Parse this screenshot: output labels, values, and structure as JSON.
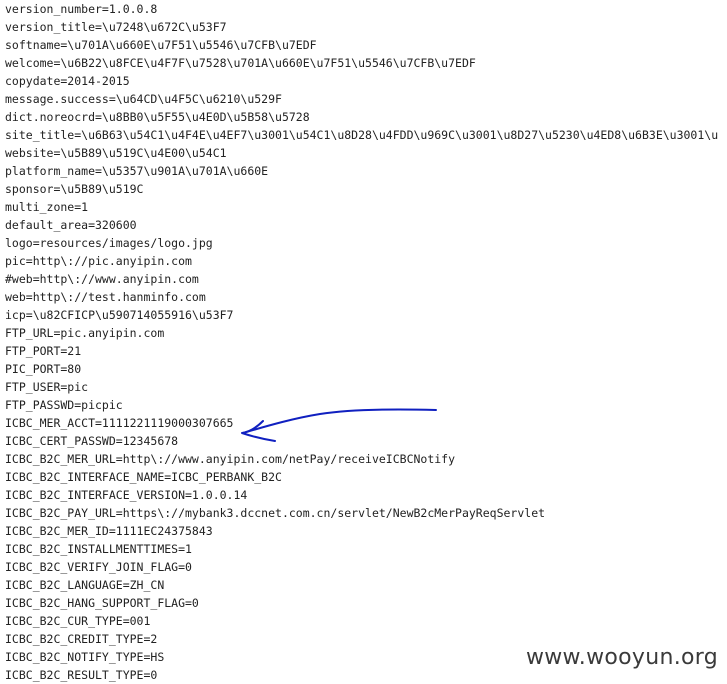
{
  "file": {
    "lines": [
      "version_number=1.0.0.8",
      "version_title=\\u7248\\u672C\\u53F7",
      "softname=\\u701A\\u660E\\u7F51\\u5546\\u7CFB\\u7EDF",
      "welcome=\\u6B22\\u8FCE\\u4F7F\\u7528\\u701A\\u660E\\u7F51\\u5546\\u7CFB\\u7EDF",
      "copydate=2014-2015",
      "message.success=\\u64CD\\u4F5C\\u6210\\u529F",
      "dict.noreocrd=\\u8BB0\\u5F55\\u4E0D\\u5B58\\u5728",
      "site_title=\\u6B63\\u54C1\\u4F4E\\u4EF7\\u3001\\u54C1\\u8D28\\u4FDD\\u969C\\u3001\\u8D27\\u5230\\u4ED8\\u6B3E\\u3001\\u",
      "website=\\u5B89\\u519C\\u4E00\\u54C1",
      "platform_name=\\u5357\\u901A\\u701A\\u660E",
      "sponsor=\\u5B89\\u519C",
      "multi_zone=1",
      "default_area=320600",
      "logo=resources/images/logo.jpg",
      "pic=http\\://pic.anyipin.com",
      "#web=http\\://www.anyipin.com",
      "web=http\\://test.hanminfo.com",
      "icp=\\u82CFICP\\u590714055916\\u53F7",
      "FTP_URL=pic.anyipin.com",
      "FTP_PORT=21",
      "PIC_PORT=80",
      "FTP_USER=pic",
      "FTP_PASSWD=picpic",
      "ICBC_MER_ACCT=1111221119000307665",
      "ICBC_CERT_PASSWD=12345678",
      "ICBC_B2C_MER_URL=http\\://www.anyipin.com/netPay/receiveICBCNotify",
      "ICBC_B2C_INTERFACE_NAME=ICBC_PERBANK_B2C",
      "ICBC_B2C_INTERFACE_VERSION=1.0.0.14",
      "ICBC_B2C_PAY_URL=https\\://mybank3.dccnet.com.cn/servlet/NewB2cMerPayReqServlet",
      "ICBC_B2C_MER_ID=1111EC24375843",
      "ICBC_B2C_INSTALLMENTTIMES=1",
      "ICBC_B2C_VERIFY_JOIN_FLAG=0",
      "ICBC_B2C_LANGUAGE=ZH_CN",
      "ICBC_B2C_HANG_SUPPORT_FLAG=0",
      "ICBC_B2C_CUR_TYPE=001",
      "ICBC_B2C_CREDIT_TYPE=2",
      "ICBC_B2C_NOTIFY_TYPE=HS",
      "ICBC_B2C_RESULT_TYPE=0"
    ]
  },
  "annotation": {
    "color": "#1020c0",
    "icon": "hand-drawn-arrow-icon"
  },
  "watermark": {
    "text": "www.wooyun.org"
  }
}
